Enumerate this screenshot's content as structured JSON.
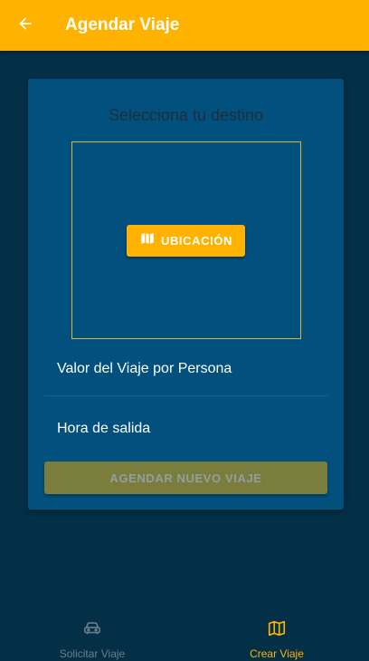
{
  "appbar": {
    "title": "Agendar Viaje",
    "back_icon": "arrow-left-icon"
  },
  "card": {
    "heading": "Selecciona tu destino",
    "location_button": {
      "label": "UBICACIÓN",
      "icon": "map-icon"
    },
    "fields": {
      "price_label": "Valor del Viaje por Persona",
      "departure_label": "Hora de salida"
    },
    "submit_button": {
      "label": "AGENDAR NUEVO VIAJE",
      "enabled": false
    }
  },
  "bottom_nav": {
    "items": [
      {
        "label": "Solicitar Viaje",
        "icon": "car-icon",
        "active": false
      },
      {
        "label": "Crear Viaje",
        "icon": "map-icon",
        "active": true
      }
    ]
  },
  "colors": {
    "primary": "#ffb300",
    "background": "#032f47",
    "card": "#02507d",
    "disabled_button": "#7a7d3c"
  }
}
